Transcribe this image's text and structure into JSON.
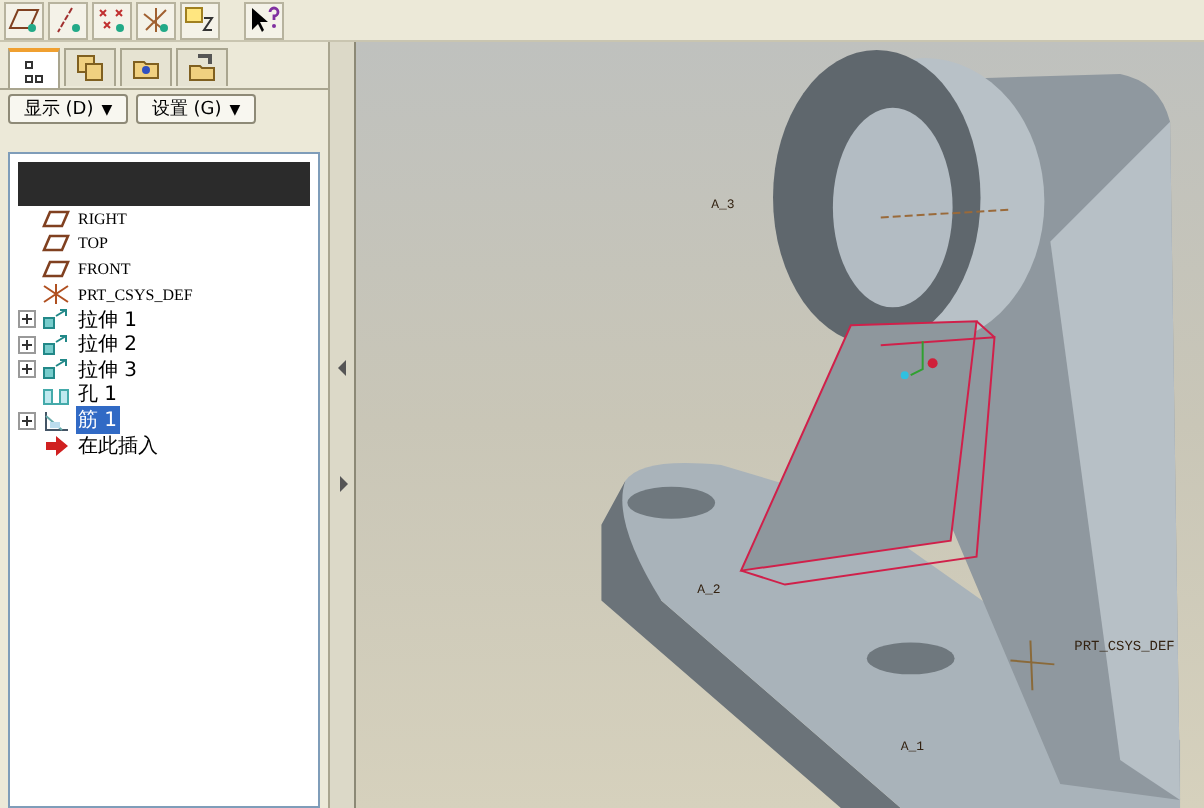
{
  "toolbar": {
    "buttons": [
      {
        "kind": "plane"
      },
      {
        "kind": "axis"
      },
      {
        "kind": "point"
      },
      {
        "kind": "csys"
      },
      {
        "kind": "sketch"
      },
      {
        "kind": "help"
      }
    ]
  },
  "panel_tabs": [
    {
      "kind": "tree",
      "selected": true
    },
    {
      "kind": "layers",
      "selected": false
    },
    {
      "kind": "folder",
      "selected": false
    },
    {
      "kind": "favorites",
      "selected": false
    }
  ],
  "panel_buttons": [
    {
      "label": "显示 (D)",
      "caret": "▼"
    },
    {
      "label": "设置 (G)",
      "caret": "▼"
    }
  ],
  "tree": [
    {
      "label": "RIGHT",
      "kind": "plane",
      "expandable": false,
      "selected": false
    },
    {
      "label": "TOP",
      "kind": "plane",
      "expandable": false,
      "selected": false
    },
    {
      "label": "FRONT",
      "kind": "plane",
      "expandable": false,
      "selected": false
    },
    {
      "label": "PRT_CSYS_DEF",
      "kind": "csys",
      "expandable": false,
      "selected": false
    },
    {
      "label": "拉伸 1",
      "kind": "extrude",
      "expandable": true,
      "selected": false
    },
    {
      "label": "拉伸 2",
      "kind": "extrude",
      "expandable": true,
      "selected": false
    },
    {
      "label": "拉伸 3",
      "kind": "extrude",
      "expandable": true,
      "selected": false
    },
    {
      "label": "孔 1",
      "kind": "hole",
      "expandable": false,
      "selected": false
    },
    {
      "label": "筋 1",
      "kind": "rib",
      "expandable": true,
      "selected": true
    },
    {
      "label": "在此插入",
      "kind": "insert",
      "expandable": false,
      "selected": false
    }
  ],
  "viewport": {
    "labels": [
      {
        "text": "A_3",
        "kind": "axis"
      },
      {
        "text": "A_2",
        "kind": "axis"
      },
      {
        "text": "PRT_CSYS_DEF",
        "kind": "csys"
      },
      {
        "text": "A_1",
        "kind": "axis"
      }
    ]
  }
}
